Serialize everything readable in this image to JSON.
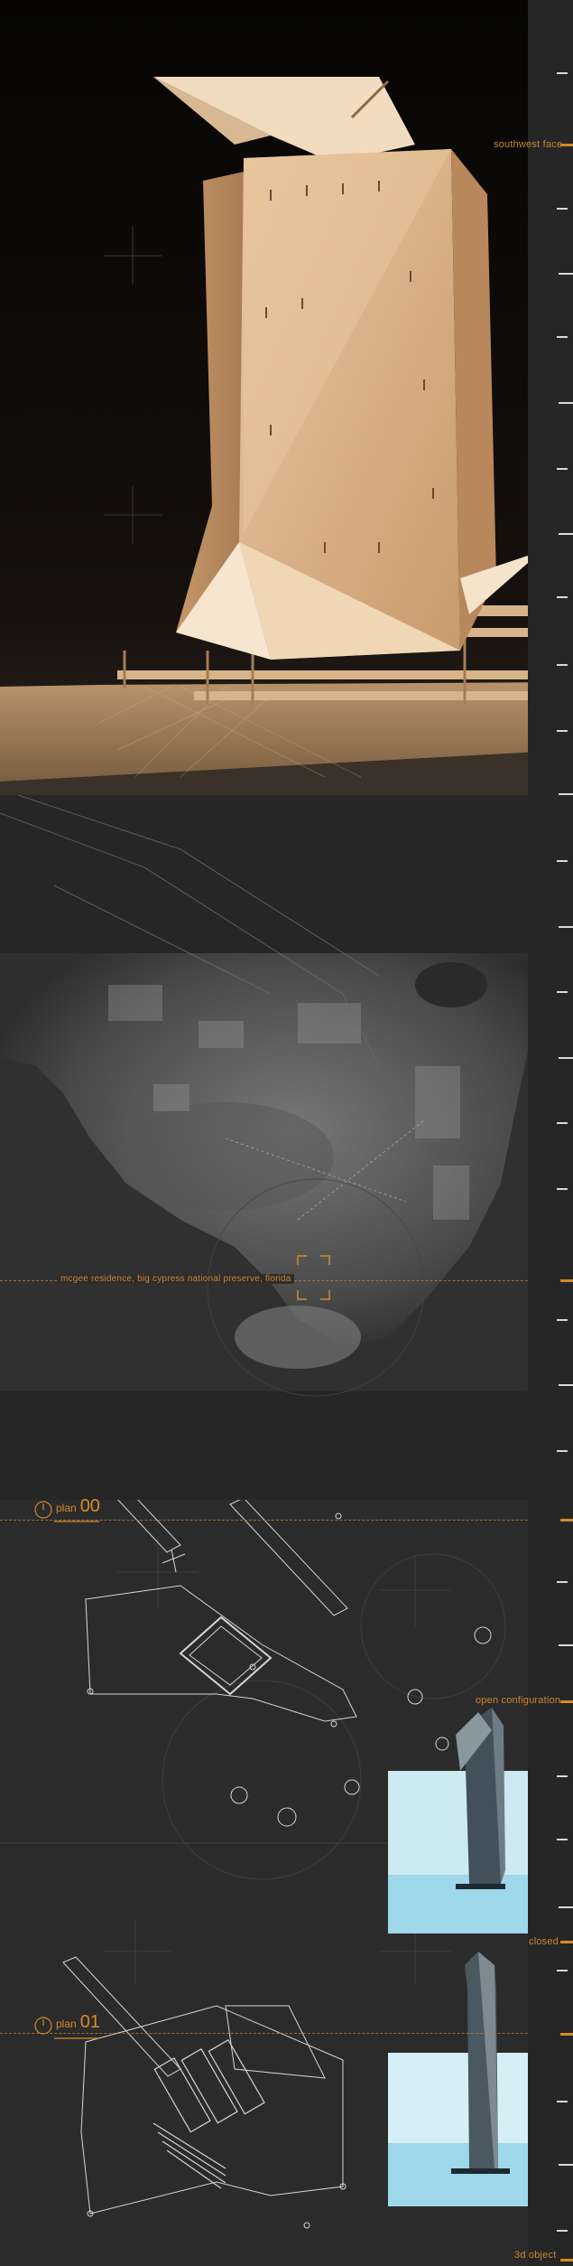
{
  "labels": {
    "southwest_face": "southwest face",
    "site_caption": "mcgee residence, big cypress national preserve, florida",
    "open_configuration": "open configuration",
    "closed": "closed",
    "object_3d": "3d object"
  },
  "plan_00": {
    "prefix": "plan",
    "number": "00"
  },
  "plan_01": {
    "prefix": "plan",
    "number": "01"
  },
  "colors": {
    "accent": "#d58a2c",
    "background": "#2a2a2a",
    "wood": "#d9b48a"
  }
}
